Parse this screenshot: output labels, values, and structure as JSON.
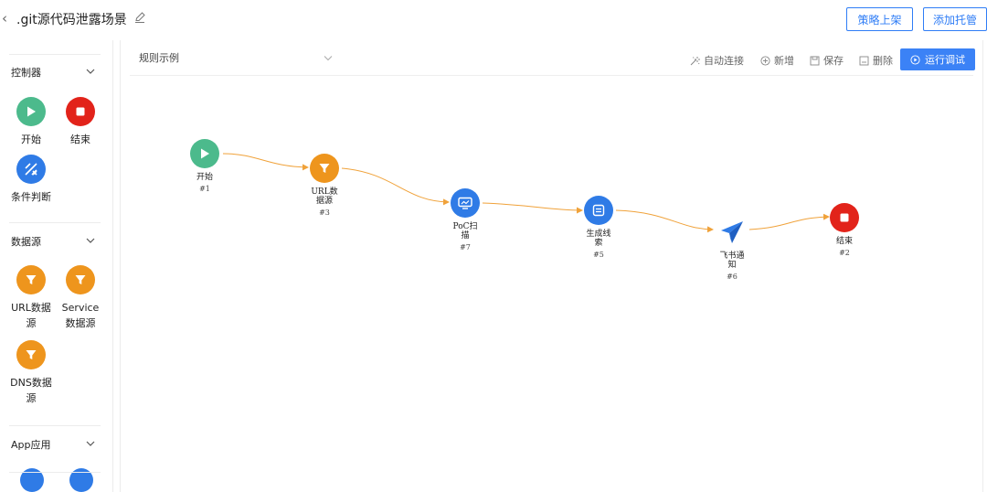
{
  "header": {
    "title": ".git源代码泄露场景",
    "publish_label": "策略上架",
    "hosting_label": "添加托管"
  },
  "sidebar": {
    "sections": [
      {
        "title": "控制器",
        "items": [
          {
            "label": "开始",
            "icon": "play-icon",
            "color": "#4cba8c"
          },
          {
            "label": "结束",
            "icon": "stop-icon",
            "color": "#e2231a"
          },
          {
            "label": "条件判断",
            "icon": "condition-icon",
            "color": "#2f7be6"
          }
        ]
      },
      {
        "title": "数据源",
        "items": [
          {
            "label": "URL数据源",
            "icon": "filter-icon",
            "color": "#ee951d"
          },
          {
            "label": "Service数据源",
            "icon": "filter-icon",
            "color": "#ee951d"
          },
          {
            "label": "DNS数据源",
            "icon": "filter-icon",
            "color": "#ee951d"
          }
        ]
      },
      {
        "title": "App应用",
        "items": []
      }
    ]
  },
  "toolbar": {
    "rule_select": "规则示例",
    "auto_connect": "自动连接",
    "add": "新增",
    "save": "保存",
    "delete": "删除",
    "run_debug": "运行调试"
  },
  "flow": {
    "nodes": [
      {
        "id": "#1",
        "label_lines": [
          "开始"
        ],
        "icon": "play-icon",
        "color": "#4cba8c"
      },
      {
        "id": "#3",
        "label_lines": [
          "URL数",
          "据源"
        ],
        "icon": "filter-icon",
        "color": "#ee951d"
      },
      {
        "id": "#7",
        "label_lines": [
          "PoC扫",
          "描"
        ],
        "icon": "monitor-icon",
        "color": "#2f7be6"
      },
      {
        "id": "#5",
        "label_lines": [
          "生成线",
          "索"
        ],
        "icon": "document-icon",
        "color": "#2f7be6"
      },
      {
        "id": "#6",
        "label_lines": [
          "飞书通",
          "知"
        ],
        "icon": "paper-plane-icon",
        "color": "#2f7be6"
      },
      {
        "id": "#2",
        "label_lines": [
          "结束"
        ],
        "icon": "stop-icon",
        "color": "#e2231a"
      }
    ],
    "edge_color": "#f0a23a"
  }
}
